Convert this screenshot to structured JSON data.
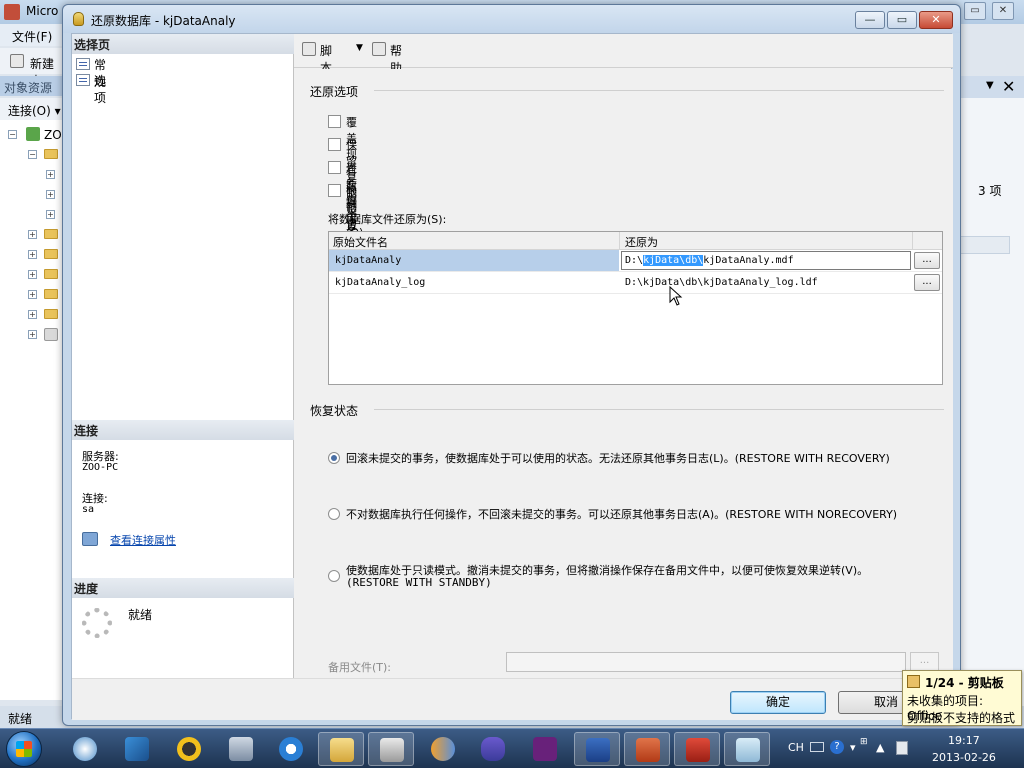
{
  "background_app": {
    "title": "Micro",
    "menu_file": "文件(F)",
    "toolbar_new": "新建查",
    "object_explorer_title": "对象资源管",
    "connect_label": "连接(O) ▾",
    "tree_root": "ZO",
    "status": "就绪",
    "right_panel_count": "3 项"
  },
  "dialog": {
    "title": "还原数据库 - kjDataAnaly",
    "select_page_header": "选择页",
    "pages": [
      {
        "label": "常规"
      },
      {
        "label": "选项"
      }
    ],
    "toolbar": {
      "script_label": "脚本",
      "help_label": "帮助"
    },
    "connection": {
      "header": "连接",
      "server_label": "服务器:",
      "server_value": "ZOO-PC",
      "connection_label": "连接:",
      "connection_value": "sa",
      "view_properties_link": "查看连接属性"
    },
    "progress": {
      "header": "进度",
      "status": "就绪"
    },
    "restore_options": {
      "header": "还原选项",
      "checkboxes": [
        {
          "label": "覆盖现有数据库(O)",
          "checked": false
        },
        {
          "label": "保留复制设置(P)",
          "checked": false
        },
        {
          "label": "还原每个备份之前进行提示(R)",
          "checked": false
        },
        {
          "label": "限制访问还原的数据库(C)",
          "checked": false
        }
      ],
      "restore_files_as_label": "将数据库文件还原为(S):",
      "grid": {
        "columns": [
          "原始文件名",
          "还原为"
        ],
        "rows": [
          {
            "original": "kjDataAnaly",
            "restore_prefix": "D:\\",
            "restore_selected": "kjData\\db\\",
            "restore_suffix": "kjDataAnaly.mdf",
            "browse": "..."
          },
          {
            "original": "kjDataAnaly_log",
            "restore_as": "D:\\kjData\\db\\kjDataAnaly_log.ldf",
            "browse": "..."
          }
        ]
      }
    },
    "recovery_state": {
      "header": "恢复状态",
      "options": [
        {
          "label": "回滚未提交的事务，使数据库处于可以使用的状态。无法还原其他事务日志(L)。(RESTORE WITH RECOVERY)",
          "selected": true
        },
        {
          "label": "不对数据库执行任何操作，不回滚未提交的事务。可以还原其他事务日志(A)。(RESTORE WITH NORECOVERY)",
          "selected": false
        },
        {
          "label": "使数据库处于只读模式。撤消未提交的事务，但将撤消操作保存在备用文件中，以便可使恢复效果逆转(V)。",
          "label_line2": "(RESTORE WITH STANDBY)",
          "selected": false
        }
      ],
      "standby_file_label": "备用文件(T):",
      "standby_file_value": "",
      "standby_browse": "..."
    },
    "buttons": {
      "ok": "确定",
      "cancel": "取消"
    },
    "window_controls": {
      "minimize": "—",
      "maximize": "▭",
      "close": "✕"
    }
  },
  "clipboard_popup": {
    "title": "1/24 - 剪贴板",
    "line1": "未收集的项目: Office",
    "line2": "剪贴板不支持的格式"
  },
  "taskbar": {
    "apps": [
      "media-player",
      "bird-app",
      "qq",
      "server-manager",
      "internet-explorer",
      "file-explorer",
      "sql-tools",
      "app-orange",
      "visual-studio-infinity",
      "visual-studio",
      "word",
      "powerpoint",
      "toolbox",
      "notepad"
    ],
    "tray_lang": "CH",
    "time": "19:17",
    "date": "2013-02-26"
  },
  "colors": {
    "selection_highlight": "#3399ff",
    "row_selected": "#b7cfea",
    "link": "#0645ad",
    "default_button_border": "#3c7fb1"
  }
}
